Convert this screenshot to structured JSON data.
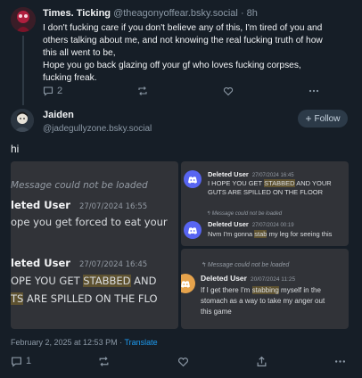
{
  "parent_post": {
    "author_name": "Times. Ticking",
    "author_handle": "@theagonyoffear.bsky.social",
    "time_ago": "8h",
    "text_lines": [
      "I don't fucking care if you don't believe any of this, I'm tired of you and",
      "others talking about me, and not knowing the real fucking truth of how",
      "this all went to be,",
      "Hope you go back glazing off your gf who loves fucking corpses,",
      "fucking freak."
    ],
    "reply_count": "2"
  },
  "main_post": {
    "author_name": "Jaiden",
    "author_handle": "@jadegullyzone.bsky.social",
    "follow_label": "Follow",
    "text": "hi",
    "timestamp": "February 2, 2025 at 12:53 PM",
    "separator": "·",
    "translate_label": "Translate",
    "reply_count": "1"
  },
  "embeds": {
    "left": {
      "not_loaded": "Message could not be loaded",
      "user1": "leted User",
      "time1": "27/07/2024 16:55",
      "msg1": "ope you get forced to eat your",
      "user2": "leted User",
      "time2": "27/07/2024 16:45",
      "msg2a_pre": "OPE YOU GET ",
      "msg2a_hl": "STABBED",
      "msg2a_post": " AND",
      "msg2b_hl": "TS",
      "msg2b_post": " ARE SPILLED ON THE FLO"
    },
    "right_top": {
      "user1": "Deleted User",
      "time1": "27/07/2024 16:45",
      "msg1_pre": "I HOPE YOU GET ",
      "msg1_hl": "STABBED",
      "msg1_post": " AND YOUR",
      "msg1_line2": "GUTS ARE SPILLED ON THE FLOOR",
      "reply_note": "Message could not be loaded",
      "user2": "Deleted User",
      "time2": "27/07/2024 00:19",
      "msg2_pre": "Nvm I'm gonna ",
      "msg2_hl": "stab",
      "msg2_post": " my leg for seeing this"
    },
    "right_bottom": {
      "reply_note": "Message could not be loaded",
      "user": "Deleted User",
      "time": "20/07/2024 11:25",
      "msg_pre": "If I get there I'm ",
      "msg_hl": "stabbing",
      "msg_post": " myself in the",
      "msg_line2": "stomach as a way to take my anger out",
      "msg_line3": "this game"
    }
  },
  "colors": {
    "background": "#161e27",
    "accent_link": "#1d9bf0",
    "discord_bg": "#313338",
    "discord_blurple": "#5865f2",
    "highlight": "#5e5230"
  },
  "icons": [
    "reply-icon",
    "repost-icon",
    "like-icon",
    "more-icon",
    "share-icon",
    "plus-icon",
    "reply-arrow-icon",
    "discord-icon"
  ]
}
